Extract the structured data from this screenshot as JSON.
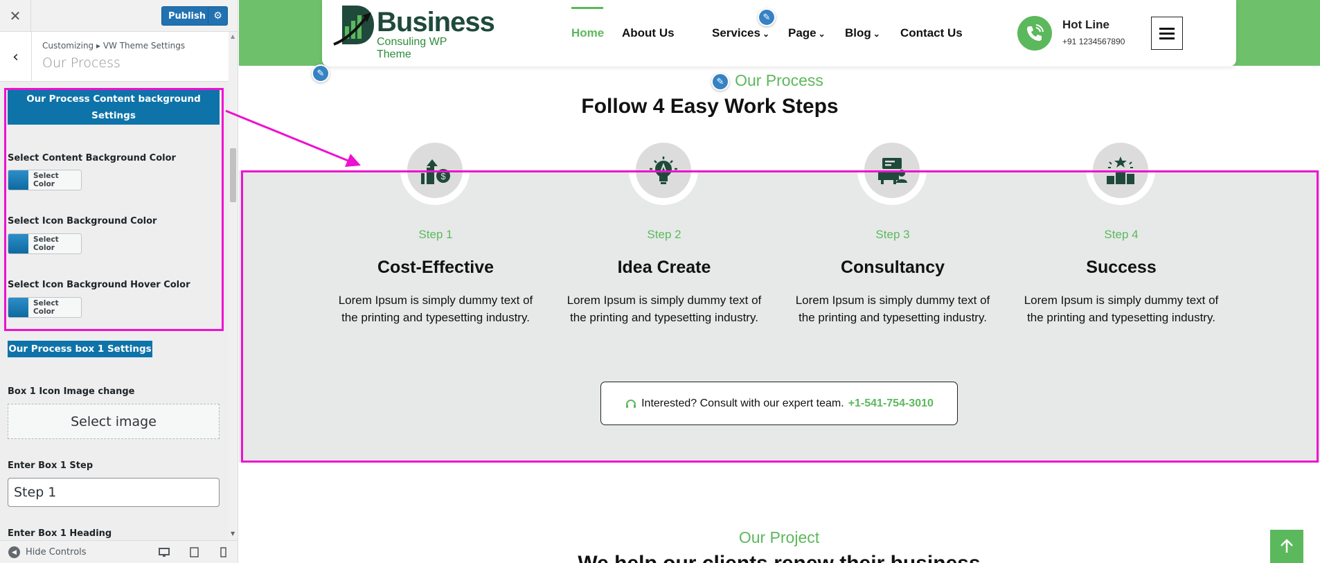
{
  "customizer": {
    "close_icon": "close-icon",
    "publish_label": "Publish",
    "breadcrumb": "Customizing ▸ VW Theme Settings",
    "section_title": "Our Process",
    "content_bg_section_heading": "Our Process Content background Settings",
    "color_fields": [
      {
        "label": "Select Content Background Color",
        "button": "Select Color"
      },
      {
        "label": "Select Icon Background Color",
        "button": "Select Color"
      },
      {
        "label": "Select Icon Background Hover Color",
        "button": "Select Color"
      }
    ],
    "box1_section_heading": "Our Process box 1 Settings",
    "box1_icon_label": "Box 1 Icon Image change",
    "select_image_label": "Select image",
    "box1_step_label": "Enter Box 1 Step",
    "box1_step_value": "Step 1",
    "box1_heading_label": "Enter Box 1 Heading",
    "hide_controls_label": "Hide Controls"
  },
  "site": {
    "logo_title": "Business",
    "logo_subtitle": "Consuling WP Theme",
    "nav": [
      {
        "label": "Home",
        "active": true
      },
      {
        "label": "About Us"
      },
      {
        "label": "Services",
        "dropdown": true
      },
      {
        "label": "Page",
        "dropdown": true
      },
      {
        "label": "Blog",
        "dropdown": true
      },
      {
        "label": "Contact Us"
      }
    ],
    "hotline_title": "Hot Line",
    "hotline_number": "+91 1234567890",
    "accent_color": "#5cb85c"
  },
  "process": {
    "eyebrow": "Our Process",
    "title": "Follow 4 Easy Work Steps",
    "steps": [
      {
        "step": "Step 1",
        "heading": "Cost-Effective",
        "desc": "Lorem Ipsum is simply dummy text of the printing and typesetting industry.",
        "icon": "money-growth-icon"
      },
      {
        "step": "Step 2",
        "heading": "Idea Create",
        "desc": "Lorem Ipsum is simply dummy text of the printing and typesetting industry.",
        "icon": "lightbulb-icon"
      },
      {
        "step": "Step 3",
        "heading": "Consultancy",
        "desc": "Lorem Ipsum is simply dummy text of the printing and typesetting industry.",
        "icon": "consultant-icon"
      },
      {
        "step": "Step 4",
        "heading": "Success",
        "desc": "Lorem Ipsum is simply dummy text of the printing and typesetting industry.",
        "icon": "podium-icon"
      }
    ],
    "consult_text": "Interested? Consult with our expert team.",
    "consult_phone": "+1-541-754-3010"
  },
  "project": {
    "eyebrow": "Our Project",
    "title": "We help our clients renew their business"
  }
}
